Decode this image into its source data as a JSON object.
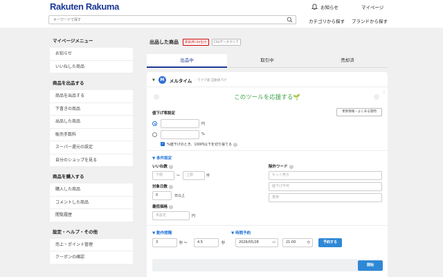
{
  "header": {
    "logo_brand": "Rakuten",
    "logo_name": "Rakuma",
    "notice_label": "お知らせ",
    "mypage_label": "マイページ",
    "search_placeholder": "キーワードで探す",
    "category_label": "カテゴリから探す",
    "brand_label": "ブランドから探す"
  },
  "sidebar": {
    "sections": [
      {
        "title": "マイページメニュー",
        "items": [
          "お知らせ",
          "いいねした商品"
        ]
      },
      {
        "title": "商品を出品する",
        "items": [
          "商品を出品する",
          "下書きの商品",
          "出品した商品",
          "販売手数料",
          "スーパー還元の設定",
          "自分のショップを見る"
        ]
      },
      {
        "title": "商品を購入する",
        "items": [
          "購入した商品",
          "コメントした商品",
          "閲覧履歴"
        ]
      },
      {
        "title": "設定・ヘルプ・その他",
        "items": [
          "売上・ポイント管理",
          "クーポンの確認"
        ]
      }
    ]
  },
  "main": {
    "title": "出品した商品",
    "csv_button": "売前済CSV出力",
    "csv_clear_button": "CSVデータクリア",
    "tabs": [
      "出品中",
      "取引中",
      "売却済"
    ],
    "active_tab": 0
  },
  "tool": {
    "name": "メルタイム",
    "subtitle": "- ラクマ版 自動値下げ",
    "support_text": "このツールを応援する🌱",
    "price_down_label": "値下げ率設定",
    "update_help_button": "更新情報・よくある質問",
    "yen_unit": "円",
    "percent_unit": "%",
    "round_checkbox_label": "%値下げのとき、100円以下を切り捨てる",
    "conditions_label": "▼ 条件設定",
    "likes_label": "いいね数",
    "likes_lower_placeholder": "下限",
    "likes_upper_placeholder": "上限",
    "tilde": "〜",
    "count_unit": "件",
    "exclude_words_label": "除外ワード",
    "exclude_placeholder_1": "セット売り",
    "exclude_placeholder_2": "値下げ不可",
    "exclude_placeholder_3": "専用",
    "days_label": "対象日数",
    "days_value": "0",
    "days_unit": "日以上",
    "min_price_label": "最低価格",
    "min_price_placeholder": "未設定",
    "interval_label": "▼ 動作間隔",
    "interval_min": "3",
    "interval_max": "4.5",
    "sec_unit": "秒",
    "tilde2": "〜",
    "schedule_label": "▼ 時間予約",
    "schedule_date": "2026/05/28",
    "schedule_time": "21:00",
    "schedule_button": "予約する",
    "start_button": "開始"
  },
  "colors": {
    "brand_blue": "#1d3995",
    "accent_blue": "#2f88d6",
    "support_green": "#3ca348",
    "csv_red": "#cc0000"
  }
}
